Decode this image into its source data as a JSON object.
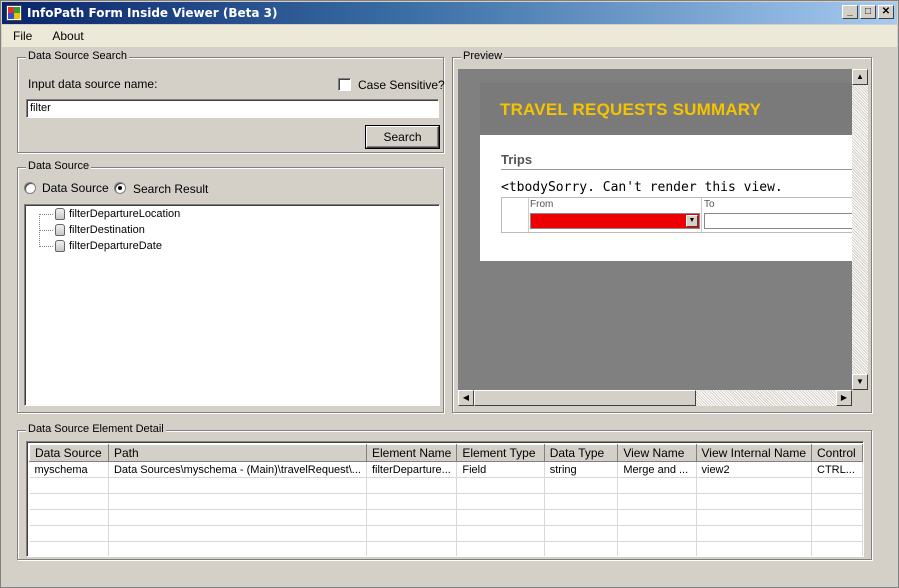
{
  "window": {
    "title": "InfoPath Form Inside Viewer (Beta 3)",
    "min": "_",
    "max": "□",
    "close": "✕"
  },
  "menu": {
    "items": [
      "File",
      "About"
    ]
  },
  "search_group": {
    "title": "Data Source Search",
    "input_label": "Input data source name:",
    "case_label": "Case Sensitive?",
    "case_checked": false,
    "input_value": "filter",
    "button_label": "Search"
  },
  "datasource_group": {
    "title": "Data Source",
    "radio_datasource": "Data Source",
    "radio_search": "Search Result",
    "selected": "Search Result",
    "tree_items": [
      "filterDepartureLocation",
      "filterDestination",
      "filterDepartureDate"
    ]
  },
  "preview": {
    "title": "Preview",
    "form_title": "TRAVEL REQUESTS SUMMARY",
    "section": "Trips",
    "error": "<tbodySorry. Can't render this view.",
    "col_from": "From",
    "col_to": "To",
    "from_color": "#ee0000"
  },
  "detail_group": {
    "title": "Data Source Element Detail",
    "columns": [
      "Data Source",
      "Path",
      "Element Name",
      "Element Type",
      "Data Type",
      "View Name",
      "View Internal Name",
      "Control"
    ],
    "rows": [
      [
        "myschema",
        "Data Sources\\myschema - (Main)\\travelRequest\\...",
        "filterDeparture...",
        "Field",
        "string",
        "Merge and ...",
        "view2",
        "CTRL..."
      ]
    ]
  }
}
